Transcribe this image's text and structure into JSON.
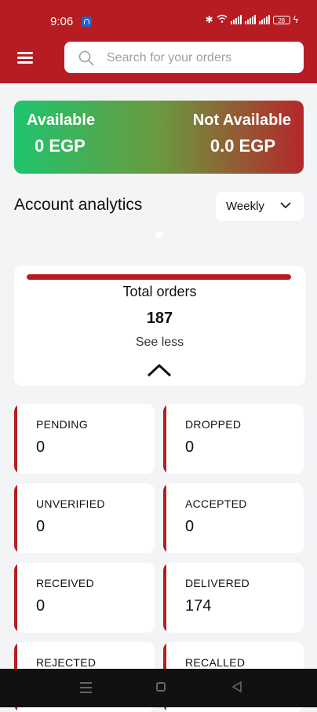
{
  "status_bar": {
    "time": "9:06",
    "battery": "28"
  },
  "search": {
    "placeholder": "Search for your orders"
  },
  "balance": {
    "available_label": "Available",
    "available_value": "0 EGP",
    "not_available_label": "Not Available",
    "not_available_value": "0.0 EGP",
    "gradient_start": "#1fc46e",
    "gradient_end": "#b5272b"
  },
  "analytics": {
    "title": "Account analytics",
    "period": "Weekly"
  },
  "total_orders": {
    "title": "Total orders",
    "value": "187",
    "toggle_label": "See less"
  },
  "stats": [
    {
      "label": "PENDING",
      "value": "0"
    },
    {
      "label": "DROPPED",
      "value": "0"
    },
    {
      "label": "UNVERIFIED",
      "value": "0"
    },
    {
      "label": "ACCEPTED",
      "value": "0"
    },
    {
      "label": "RECEIVED",
      "value": "0"
    },
    {
      "label": "DELIVERED",
      "value": "174"
    },
    {
      "label": "REJECTED",
      "value": ""
    },
    {
      "label": "RECALLED",
      "value": ""
    }
  ],
  "colors": {
    "brand": "#b71c23",
    "background": "#f3f4f6"
  }
}
